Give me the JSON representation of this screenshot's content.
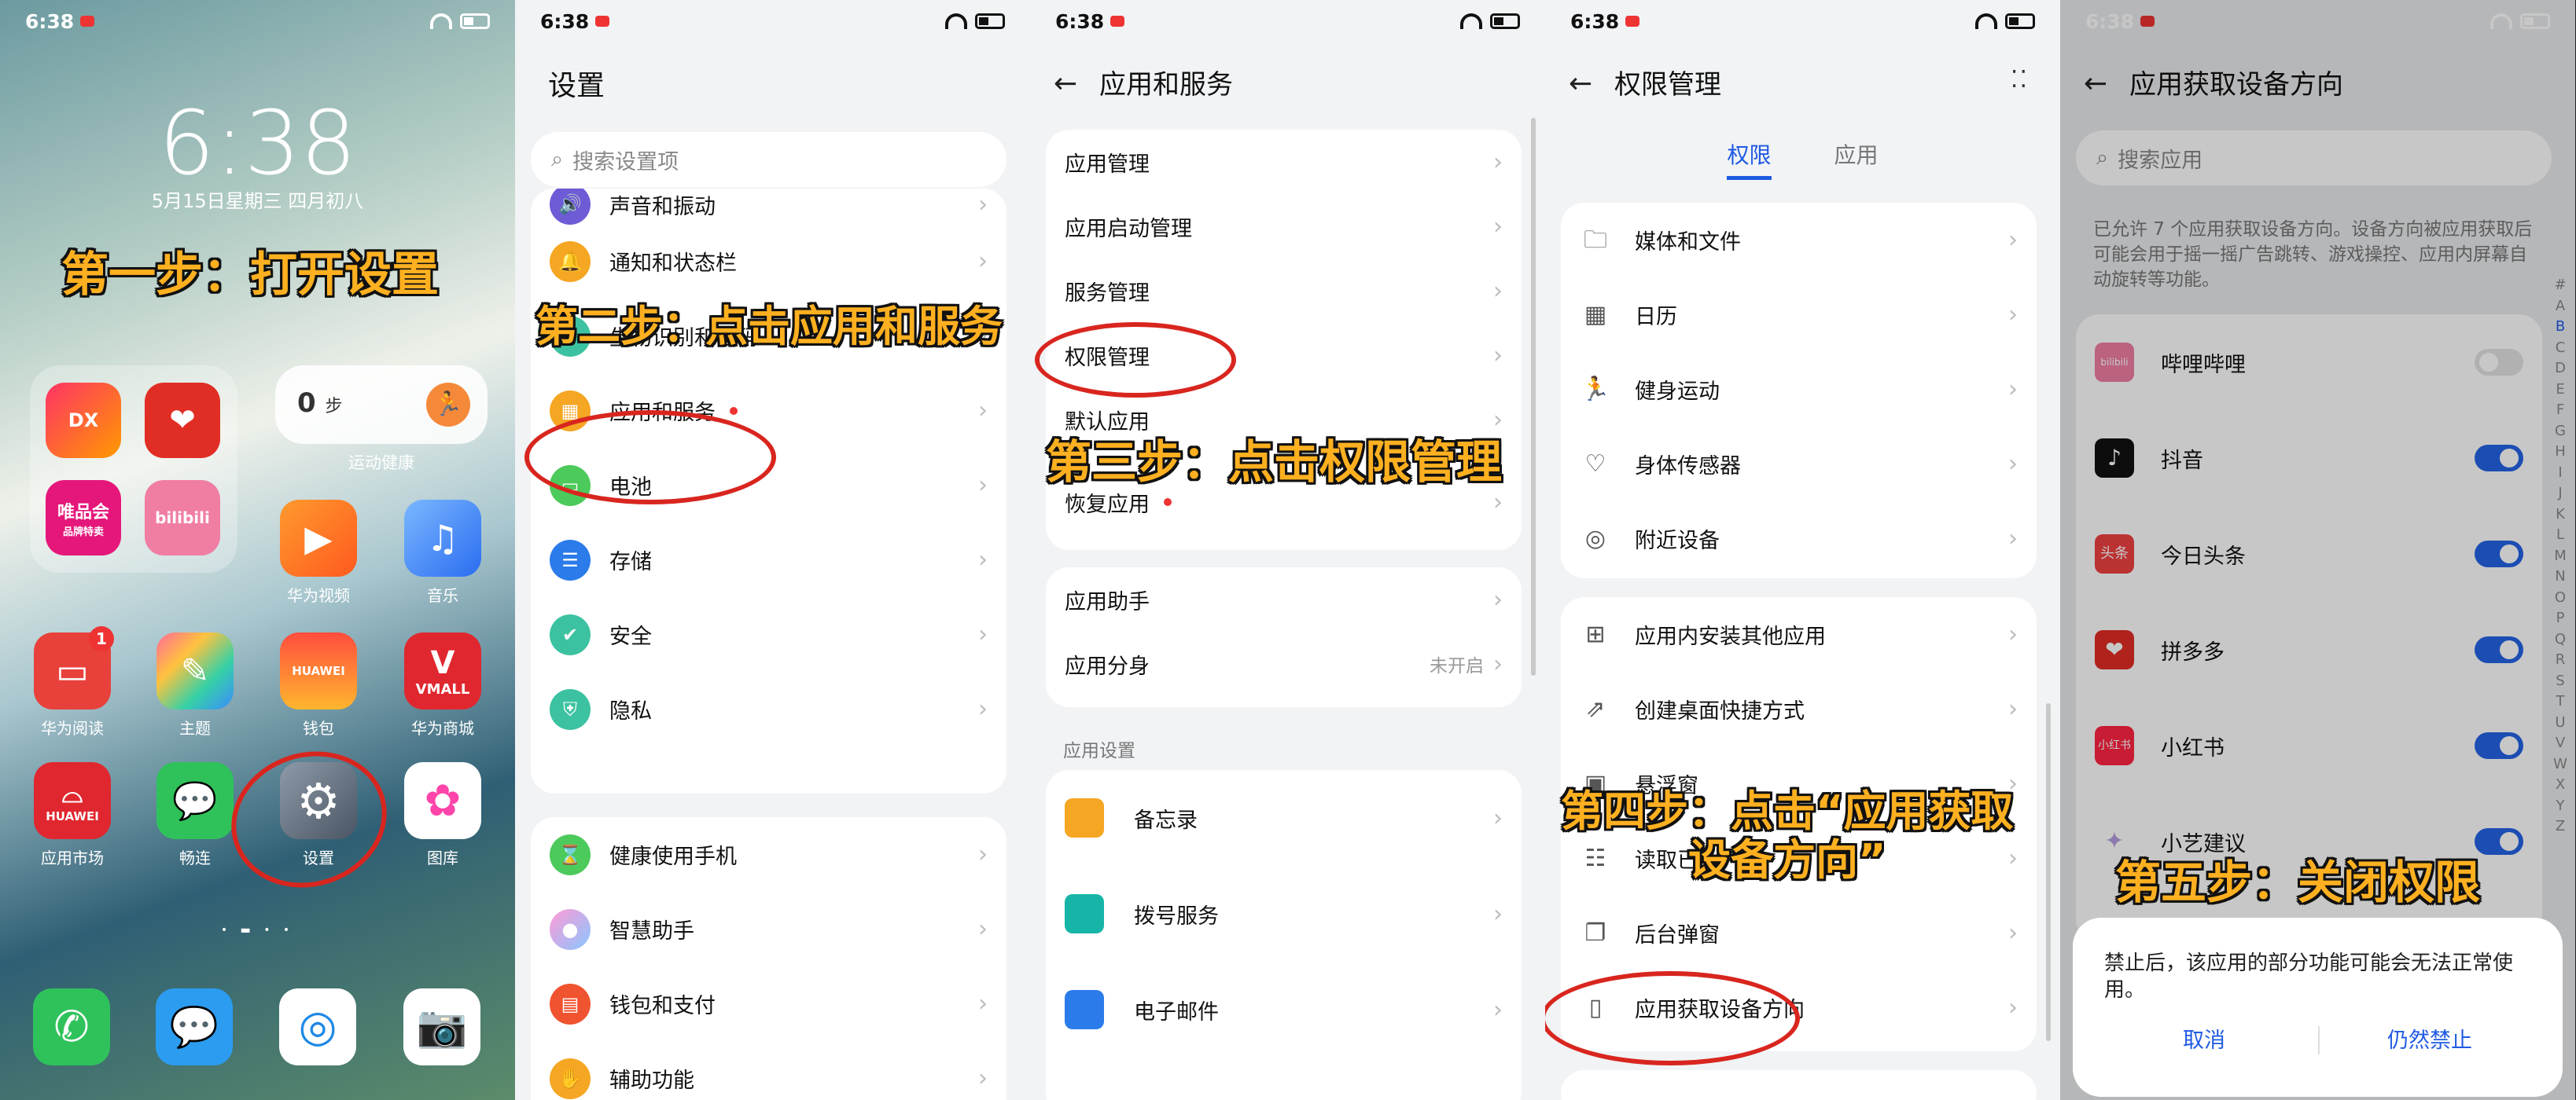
{
  "status": {
    "time": "6:38"
  },
  "home": {
    "clock": "6:38",
    "date": "5月15日星期三  四月初八",
    "steps_value": "0",
    "steps_unit": "步",
    "widget_caption": "运动健康",
    "mini_apps": [
      "DX",
      "拼多多",
      "唯品会",
      "bilibili"
    ],
    "vip_text": "唯品会",
    "vip_sub": "品牌特卖",
    "apps": [
      {
        "label": "华为视频"
      },
      {
        "label": "音乐"
      },
      {
        "label": "华为阅读",
        "badge": "1"
      },
      {
        "label": "主题"
      },
      {
        "label": "钱包"
      },
      {
        "label": "华为商城"
      },
      {
        "label": "应用市场"
      },
      {
        "label": "畅连"
      },
      {
        "label": "设置"
      },
      {
        "label": "图库"
      }
    ],
    "app_brand_texts": {
      "wallet": "HUAWEI",
      "vmall": "VMALL",
      "appmarket": "HUAWEI"
    },
    "annotation": "第一步：打开设置"
  },
  "settings": {
    "title": "设置",
    "search_placeholder": "搜索设置项",
    "items_top": [
      "声音和振动",
      "通知和状态栏",
      "生物识别和密码",
      "应用和服务",
      "电池",
      "存储",
      "安全",
      "隐私"
    ],
    "items_bottom": [
      "健康使用手机",
      "智慧助手",
      "钱包和支付",
      "辅助功能"
    ],
    "annotation": "第二步：点击应用和服务"
  },
  "apps_services": {
    "title": "应用和服务",
    "group1": [
      "应用管理",
      "应用启动管理",
      "服务管理",
      "权限管理",
      "默认应用",
      "恢复应用"
    ],
    "group2": [
      {
        "label": "应用助手",
        "value": ""
      },
      {
        "label": "应用分身",
        "value": "未开启"
      }
    ],
    "section": "应用设置",
    "group3": [
      "备忘录",
      "拨号服务",
      "电子邮件"
    ],
    "annotation": "第三步：点击权限管理"
  },
  "permissions": {
    "title": "权限管理",
    "tabs": [
      "权限",
      "应用"
    ],
    "group1": [
      "媒体和文件",
      "日历",
      "健身运动",
      "身体传感器",
      "附近设备"
    ],
    "group2": [
      "应用内安装其他应用",
      "创建桌面快捷方式",
      "悬浮窗",
      "读取已",
      "后台弹窗",
      "应用获取设备方向"
    ],
    "annotation_line1": "第四步：点击“应用获取",
    "annotation_line2": "设备方向”"
  },
  "orientation": {
    "title": "应用获取设备方向",
    "search_placeholder": "搜索应用",
    "description": "已允许 7 个应用获取设备方向。设备方向被应用获取后可能会用于摇一摇广告跳转、游戏操控、应用内屏幕自动旋转等功能。",
    "apps": [
      {
        "name": "哔哩哔哩",
        "on": false,
        "icon_text": "bilibili",
        "color": "#f07ea3"
      },
      {
        "name": "抖音",
        "on": true,
        "icon_text": "♪",
        "color": "#111111"
      },
      {
        "name": "今日头条",
        "on": true,
        "icon_text": "头条",
        "color": "#f04142"
      },
      {
        "name": "拼多多",
        "on": true,
        "icon_text": "❤",
        "color": "#e02e24"
      },
      {
        "name": "小红书",
        "on": true,
        "icon_text": "小红书",
        "color": "#ff2442"
      },
      {
        "name": "小艺建议",
        "on": true,
        "icon_text": "✦",
        "color": "#b39ddb"
      }
    ],
    "alphabet": [
      "#",
      "A",
      "B",
      "C",
      "D",
      "E",
      "F",
      "G",
      "H",
      "I",
      "J",
      "K",
      "L",
      "M",
      "N",
      "O",
      "P",
      "Q",
      "R",
      "S",
      "T",
      "U",
      "V",
      "W",
      "X",
      "Y",
      "Z"
    ],
    "dialog": {
      "message": "禁止后，该应用的部分功能可能会无法正常使用。",
      "cancel": "取消",
      "confirm": "仍然禁止"
    },
    "annotation": "第五步：关闭权限"
  },
  "colors": {
    "accent": "#1f5ae3",
    "annotation": "#ffb020",
    "highlight_ring": "#d8261f"
  }
}
